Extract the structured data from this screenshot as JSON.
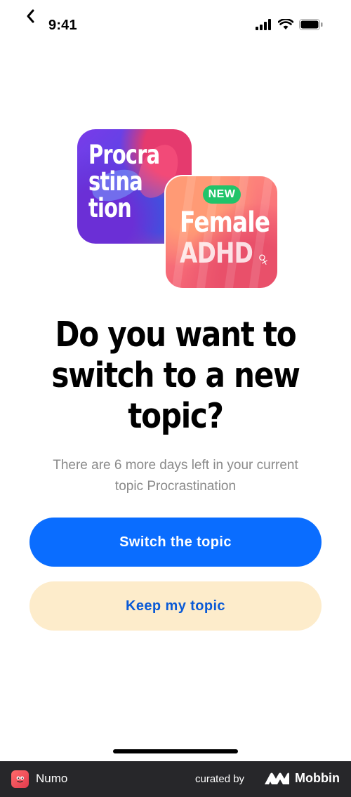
{
  "status_bar": {
    "time": "9:41"
  },
  "artwork": {
    "procrastination_tile_text": "Procra\nstina\ntion",
    "adhd_badge": "NEW",
    "adhd_line1": "Female",
    "adhd_line2": "ADHD"
  },
  "content": {
    "headline": "Do you want to switch to a new topic?",
    "subtitle": "There are 6 more days left in your current topic Procrastination"
  },
  "actions": {
    "primary_label": "Switch the topic",
    "secondary_label": "Keep my topic"
  },
  "footer": {
    "app_name": "Numo",
    "curated_by": "curated by",
    "brand": "Mobbin"
  },
  "colors": {
    "primary_button": "#0a6dff",
    "secondary_button": "#fdeccb",
    "secondary_text": "#0a5ad6",
    "new_badge": "#21c46a"
  }
}
